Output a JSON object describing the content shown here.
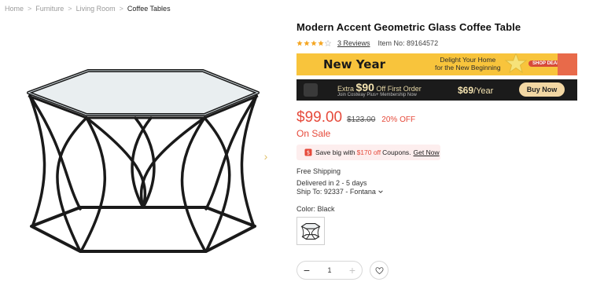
{
  "breadcrumb": {
    "items": [
      "Home",
      "Furniture",
      "Living Room",
      "Coffee Tables"
    ],
    "separator": ">"
  },
  "product": {
    "title": "Modern Accent Geometric Glass Coffee Table",
    "rating": 4,
    "reviews_label": "3 Reviews",
    "item_no_label": "Item No: 89164572",
    "price": "$99.00",
    "old_price": "$123.00",
    "discount": "20% OFF",
    "status": "On Sale"
  },
  "promo_banner": {
    "title": "New Year",
    "subtitle_line1": "Delight Your Home",
    "subtitle_line2": "for the New Beginning",
    "cta": "SHOP DEALS",
    "color_background": "#f8c43c"
  },
  "membership_banner": {
    "offer_prefix": "Extra",
    "offer_amount": "$90",
    "offer_suffix": "Off First Order",
    "join_text": "Join Costway Plus+ Membership Now",
    "price_amount": "$69",
    "price_unit": "/Year",
    "cta": "Buy Now"
  },
  "coupon": {
    "prefix": "Save big with",
    "amount": "$170 off",
    "suffix": "Coupons.",
    "link": "Get Now"
  },
  "shipping": {
    "free": "Free Shipping",
    "delivered": "Delivered in 2 - 5 days",
    "ship_to": "Ship To: 92337 - Fontana"
  },
  "color": {
    "label": "Color: Black",
    "selected": "Black"
  },
  "quantity": {
    "value": "1",
    "minus": "−",
    "plus": "+"
  },
  "colors": {
    "accent_red": "#e64a3b",
    "star_gold": "#f4a623",
    "frame_black": "#1a1a1a"
  }
}
